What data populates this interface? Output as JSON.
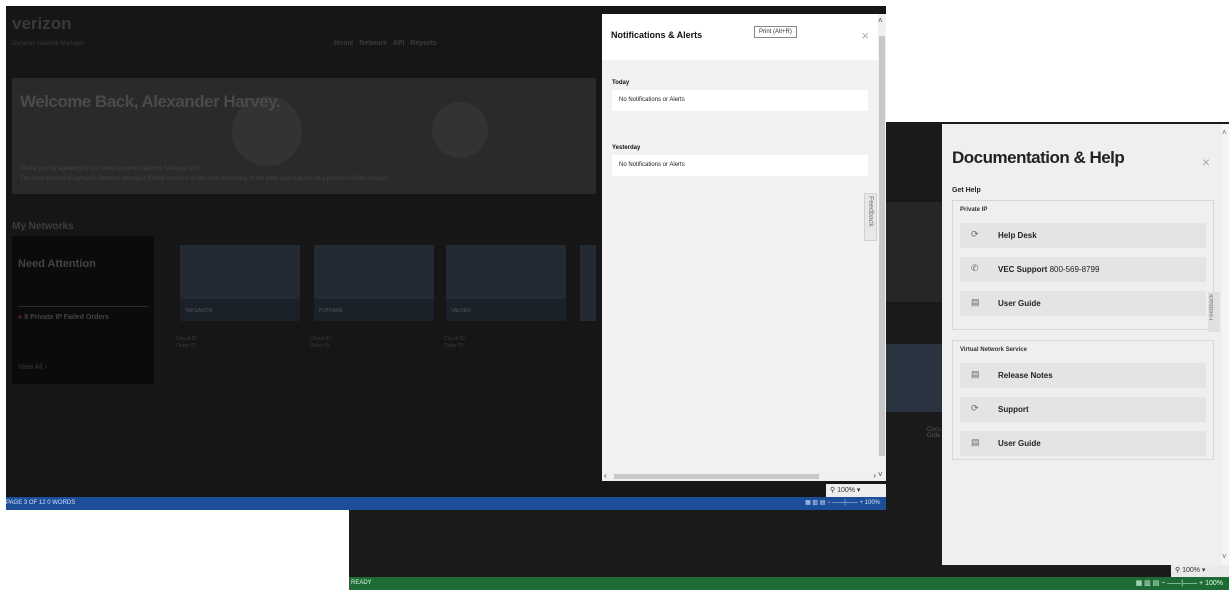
{
  "verizon": {
    "logo": "verizon",
    "subtitle": "Dynamic Network Manager",
    "nav": [
      "Home",
      "Network",
      "API",
      "Reports"
    ],
    "welcome": "Welcome Back, Alexander Harvey.",
    "hero_line1": "Thank you for agreeing to test drive Dynamic Network Manager 2.0!",
    "hero_line2": "This new version of Dynamic Network Manager (DNM) contains a new look and many of the tools and features of a previous DNM version.",
    "my_networks": "My Networks",
    "need_attention": "Need Attention",
    "failed_orders": "9 Private IP Failed Orders",
    "view_all": "View All",
    "cards": [
      {
        "name": "TAKSARON",
        "circuit": "Circuit ID: ",
        "order": "Order ID: "
      },
      {
        "name": "PUTRANE",
        "circuit": "Circuit ID: ",
        "order": "Order ID: "
      },
      {
        "name": "VALDEN",
        "circuit": "Circuit ID: ",
        "order": "Order ID: "
      }
    ]
  },
  "notifications": {
    "title": "Notifications & Alerts",
    "print_tooltip": "Print (Alt+R)",
    "close": "×",
    "sections": [
      {
        "day": "Today",
        "message": "No Notifications or Alerts"
      },
      {
        "day": "Yesterday",
        "message": "No Notifications or Alerts"
      }
    ],
    "feedback": "Feedback"
  },
  "front_status": {
    "left": "PAGE 3 OF 12   0 WORDS",
    "zoom": "100%",
    "zoom_right": "100%"
  },
  "documentation": {
    "title": "Documentation & Help",
    "close": "×",
    "get_help": "Get Help",
    "groups": [
      {
        "title": "Private IP",
        "items": [
          {
            "icon": "headset-icon",
            "label": "Help Desk",
            "number": ""
          },
          {
            "icon": "phone-icon",
            "label": "VEC Support",
            "number": "800-569-8799"
          },
          {
            "icon": "document-icon",
            "label": "User Guide",
            "number": ""
          }
        ]
      },
      {
        "title": "Virtual Network Service",
        "items": [
          {
            "icon": "document-icon",
            "label": "Release Notes",
            "number": ""
          },
          {
            "icon": "headset-icon",
            "label": "Support",
            "number": ""
          },
          {
            "icon": "document-icon",
            "label": "User Guide",
            "number": ""
          }
        ]
      }
    ],
    "feedback": "Feedback"
  },
  "back_status": {
    "left": "READY",
    "zoom": "100%",
    "zoom_right": "100%"
  }
}
